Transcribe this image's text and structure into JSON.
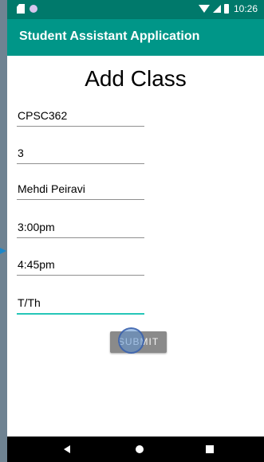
{
  "status_bar": {
    "time": "10:26",
    "icons": [
      "sd-card-icon",
      "notification-dot-icon",
      "wifi-icon",
      "signal-icon",
      "battery-icon"
    ]
  },
  "app_bar": {
    "title": "Student Assistant Application"
  },
  "screen": {
    "title": "Add Class",
    "fields": [
      {
        "name": "course-field",
        "value": "CPSC362"
      },
      {
        "name": "units-field",
        "value": "3"
      },
      {
        "name": "instructor-field",
        "value": "Mehdi Peiravi"
      },
      {
        "name": "start-time-field",
        "value": "3:00pm"
      },
      {
        "name": "end-time-field",
        "value": "4:45pm"
      },
      {
        "name": "days-field",
        "value": "T/Th"
      }
    ],
    "submit_label": "SUBMIT"
  },
  "navigation": {
    "icons": [
      "back-icon",
      "home-icon",
      "recent-apps-icon"
    ]
  },
  "colors": {
    "status_bar": "#00796B",
    "app_bar": "#009688",
    "focused_underline": "#26C6B8",
    "button": "#8A8A8A",
    "page_background": "#FFFFFF"
  }
}
